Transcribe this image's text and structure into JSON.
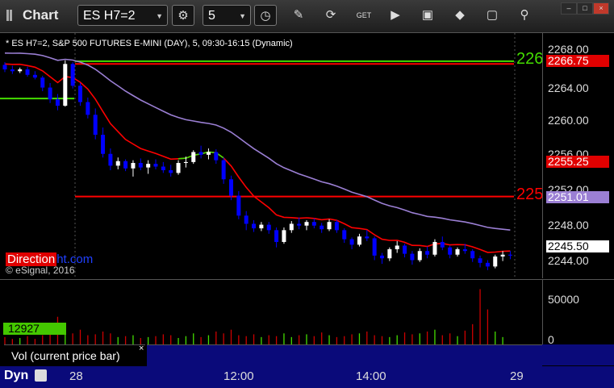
{
  "window": {
    "title": "Chart",
    "symbol": "ES H7=2",
    "interval": "5"
  },
  "toolbar": {
    "icons": [
      "gear-icon",
      "clock-icon",
      "pencil-icon",
      "refresh-icon",
      "get-icon",
      "play-icon",
      "diamond-icon",
      "comment-icon"
    ]
  },
  "study_label": "* ES H7=2, S&P 500 FUTURES E-MINI (DAY), 5, 09:30-16:15 (Dynamic)",
  "brand": {
    "part1": "Direction",
    "part2": "ht.com",
    "copyright": "© eSignal, 2016"
  },
  "price_axis": {
    "ticks": [
      "2268.00",
      "2264.00",
      "2260.00",
      "2256.00",
      "2252.00",
      "2248.00",
      "2244.00"
    ],
    "labels": [
      {
        "text": "2266.75",
        "bg": "#e00000",
        "fg": "#ffffff"
      },
      {
        "text": "2255.25",
        "bg": "#e00000",
        "fg": "#ffffff"
      },
      {
        "text": "2251.01",
        "bg": "#9b7fd4",
        "fg": "#ffffff"
      },
      {
        "text": "2245.50",
        "bg": "#ffffff",
        "fg": "#000000"
      }
    ]
  },
  "chart_labels": {
    "top_green": "226",
    "mid_red": "225"
  },
  "volume": {
    "ticks": [
      "50000",
      "0"
    ],
    "label": "12927",
    "panel_name": "Vol (current price bar)",
    "close": "×"
  },
  "time_axis": {
    "prefix": "Dyn",
    "ticks": [
      "28",
      "12:00",
      "14:00",
      "29"
    ]
  },
  "colors": {
    "up": "#ffffff",
    "down": "#0000ff",
    "ma_red": "#ff0000",
    "ma_purple": "#9b7fd4",
    "ma_green": "#44dd00"
  },
  "chart_data": {
    "type": "candlestick",
    "ylim": [
      2243.0,
      2270.0
    ],
    "candles": [
      [
        2266.5,
        2266.8,
        2265.7,
        2266.0
      ],
      [
        2266.0,
        2266.4,
        2265.5,
        2265.8
      ],
      [
        2265.8,
        2266.2,
        2265.6,
        2266.0
      ],
      [
        2266.0,
        2266.3,
        2265.2,
        2265.4
      ],
      [
        2265.4,
        2265.8,
        2264.9,
        2265.1
      ],
      [
        2265.1,
        2265.3,
        2263.6,
        2264.0
      ],
      [
        2264.0,
        2264.5,
        2262.3,
        2262.7
      ],
      [
        2262.7,
        2263.3,
        2261.5,
        2262.0
      ],
      [
        2262.0,
        2267.0,
        2261.9,
        2266.6
      ],
      [
        2266.6,
        2266.8,
        2263.9,
        2264.2
      ],
      [
        2264.2,
        2264.5,
        2262.0,
        2262.4
      ],
      [
        2262.4,
        2262.9,
        2260.6,
        2261.0
      ],
      [
        2261.0,
        2261.7,
        2258.3,
        2258.8
      ],
      [
        2258.8,
        2259.6,
        2256.3,
        2256.7
      ],
      [
        2256.7,
        2257.3,
        2254.9,
        2255.4
      ],
      [
        2255.4,
        2256.3,
        2255.0,
        2255.9
      ],
      [
        2255.9,
        2256.1,
        2254.8,
        2255.1
      ],
      [
        2255.1,
        2256.0,
        2254.2,
        2255.7
      ],
      [
        2255.7,
        2256.2,
        2254.9,
        2255.2
      ],
      [
        2255.2,
        2256.0,
        2254.5,
        2255.6
      ],
      [
        2255.6,
        2256.1,
        2255.0,
        2255.3
      ],
      [
        2255.3,
        2255.8,
        2254.6,
        2254.9
      ],
      [
        2254.9,
        2255.5,
        2254.2,
        2254.6
      ],
      [
        2254.6,
        2256.0,
        2254.4,
        2255.7
      ],
      [
        2255.7,
        2256.4,
        2255.2,
        2255.8
      ],
      [
        2255.8,
        2257.1,
        2255.6,
        2256.9
      ],
      [
        2256.9,
        2257.6,
        2256.2,
        2256.6
      ],
      [
        2256.6,
        2257.3,
        2256.1,
        2256.9
      ],
      [
        2256.9,
        2257.2,
        2255.6,
        2256.0
      ],
      [
        2256.0,
        2256.3,
        2253.4,
        2253.9
      ],
      [
        2253.9,
        2254.3,
        2251.6,
        2252.1
      ],
      [
        2252.1,
        2252.6,
        2249.5,
        2249.9
      ],
      [
        2249.9,
        2250.4,
        2248.3,
        2249.0
      ],
      [
        2249.0,
        2249.4,
        2248.1,
        2248.5
      ],
      [
        2248.5,
        2249.2,
        2248.2,
        2248.9
      ],
      [
        2248.9,
        2249.2,
        2247.9,
        2248.3
      ],
      [
        2248.3,
        2248.6,
        2246.4,
        2247.0
      ],
      [
        2247.0,
        2248.6,
        2246.8,
        2248.3
      ],
      [
        2248.3,
        2249.3,
        2248.0,
        2249.0
      ],
      [
        2249.0,
        2249.7,
        2248.4,
        2248.8
      ],
      [
        2248.8,
        2249.4,
        2248.3,
        2249.2
      ],
      [
        2249.2,
        2249.6,
        2248.5,
        2248.8
      ],
      [
        2248.8,
        2249.1,
        2248.0,
        2248.4
      ],
      [
        2248.4,
        2249.5,
        2248.2,
        2249.2
      ],
      [
        2249.2,
        2249.4,
        2248.0,
        2248.3
      ],
      [
        2248.3,
        2248.5,
        2246.9,
        2247.3
      ],
      [
        2247.3,
        2247.5,
        2246.2,
        2246.7
      ],
      [
        2246.7,
        2247.9,
        2246.5,
        2247.6
      ],
      [
        2247.6,
        2248.3,
        2247.1,
        2247.4
      ],
      [
        2247.4,
        2247.6,
        2245.0,
        2245.5
      ],
      [
        2245.5,
        2245.8,
        2244.6,
        2245.2
      ],
      [
        2245.2,
        2246.4,
        2244.9,
        2246.2
      ],
      [
        2246.2,
        2247.1,
        2245.8,
        2246.6
      ],
      [
        2246.6,
        2246.8,
        2245.3,
        2245.7
      ],
      [
        2245.7,
        2246.0,
        2244.5,
        2245.0
      ],
      [
        2245.0,
        2246.3,
        2244.8,
        2246.0
      ],
      [
        2246.0,
        2246.5,
        2245.2,
        2245.6
      ],
      [
        2245.6,
        2247.3,
        2245.4,
        2247.0
      ],
      [
        2247.0,
        2247.6,
        2246.1,
        2246.4
      ],
      [
        2246.4,
        2246.6,
        2245.2,
        2245.6
      ],
      [
        2245.6,
        2246.4,
        2245.4,
        2246.2
      ],
      [
        2246.2,
        2246.8,
        2245.7,
        2246.0
      ],
      [
        2246.0,
        2246.2,
        2244.8,
        2245.2
      ],
      [
        2245.2,
        2245.5,
        2244.2,
        2244.7
      ],
      [
        2244.7,
        2245.0,
        2243.9,
        2244.3
      ],
      [
        2244.3,
        2245.6,
        2244.1,
        2245.4
      ],
      [
        2245.4,
        2246.0,
        2244.9,
        2245.6
      ],
      [
        2245.6,
        2246.0,
        2245.1,
        2245.5
      ]
    ],
    "levels": [
      {
        "name": "green",
        "value": 2266.9,
        "color": "#44dd00"
      },
      {
        "name": "red_top",
        "value": 2266.6,
        "color": "#ff0000"
      },
      {
        "name": "red_mid",
        "value": 2252.0,
        "color": "#ff0000"
      },
      {
        "name": "green_left",
        "value": 2262.8,
        "color": "#44dd00"
      }
    ],
    "volume": [
      8,
      6,
      7,
      9,
      6,
      10,
      22,
      30,
      14,
      12,
      16,
      10,
      11,
      14,
      12,
      8,
      9,
      10,
      7,
      8,
      9,
      11,
      10,
      7,
      9,
      12,
      8,
      10,
      14,
      12,
      16,
      10,
      9,
      11,
      8,
      10,
      9,
      12,
      8,
      10,
      11,
      9,
      13,
      10,
      8,
      9,
      11,
      12,
      14,
      10,
      9,
      8,
      10,
      13,
      11,
      12,
      14,
      16,
      10,
      12,
      9,
      15,
      22,
      60,
      38,
      14,
      8
    ],
    "vol_ylim": [
      0,
      70000
    ]
  }
}
